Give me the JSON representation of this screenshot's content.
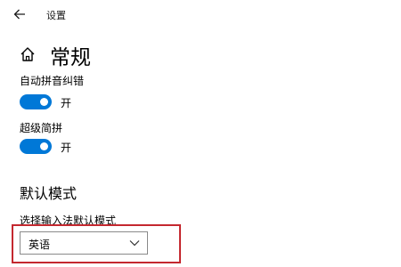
{
  "window": {
    "title": "设置",
    "back_icon": "back-arrow-icon"
  },
  "page": {
    "title": "常规",
    "icon": "home-icon"
  },
  "settings": [
    {
      "label": "自动拼音纠错",
      "state": "开",
      "on": true
    },
    {
      "label": "超级简拼",
      "state": "开",
      "on": true
    }
  ],
  "default_mode": {
    "section_title": "默认模式",
    "dropdown_label": "选择输入法默认模式",
    "dropdown_value": "英语"
  },
  "colors": {
    "toggle_on": "#0078d7",
    "highlight": "#c4282f"
  }
}
